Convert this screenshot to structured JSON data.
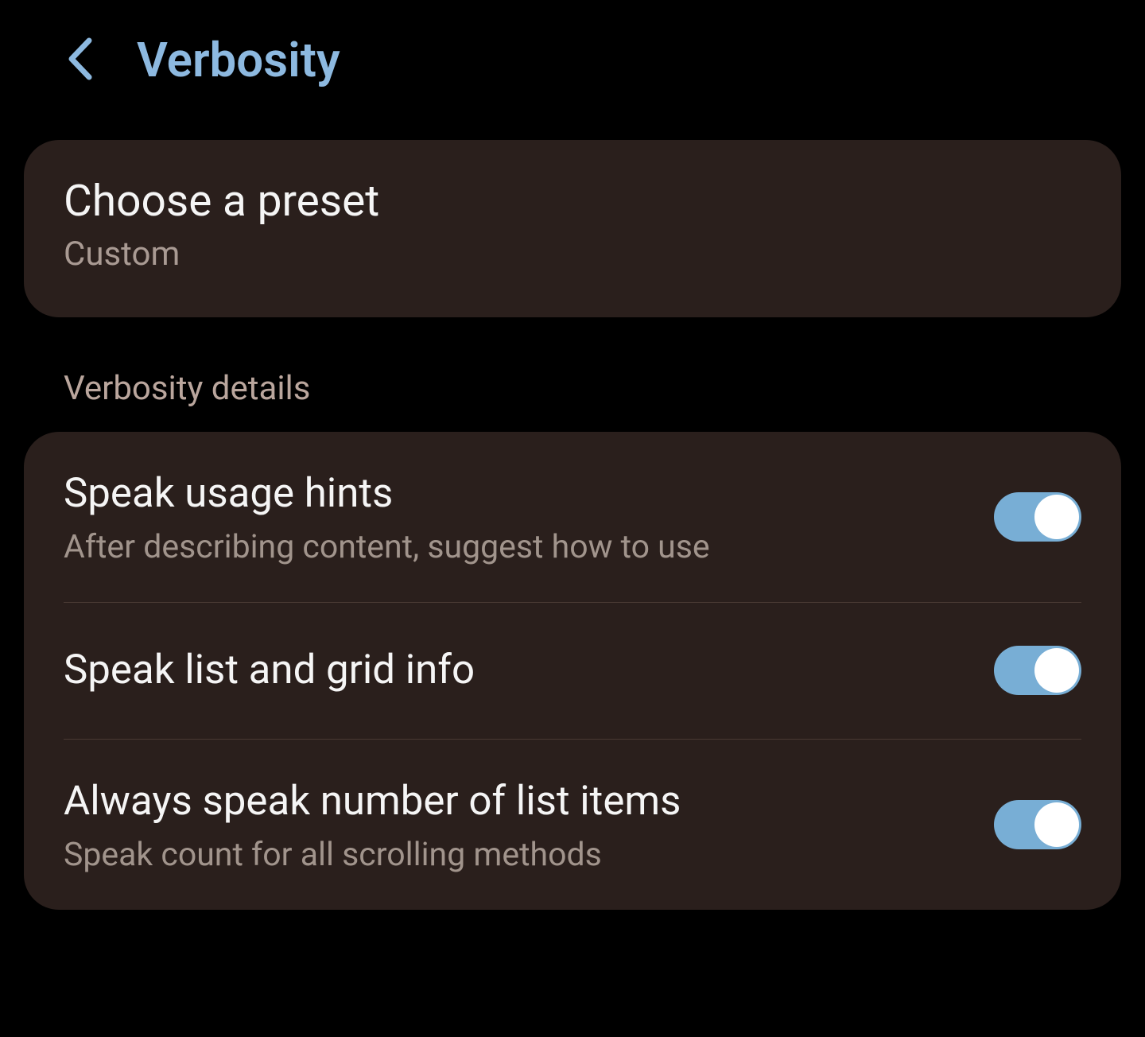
{
  "header": {
    "title": "Verbosity"
  },
  "preset": {
    "title": "Choose a preset",
    "value": "Custom"
  },
  "section_label": "Verbosity details",
  "settings": [
    {
      "title": "Speak usage hints",
      "desc": "After describing content, suggest how to use",
      "on": true
    },
    {
      "title": "Speak list and grid info",
      "desc": "",
      "on": true
    },
    {
      "title": "Always speak number of list items",
      "desc": "Speak count for all scrolling methods",
      "on": true
    }
  ]
}
